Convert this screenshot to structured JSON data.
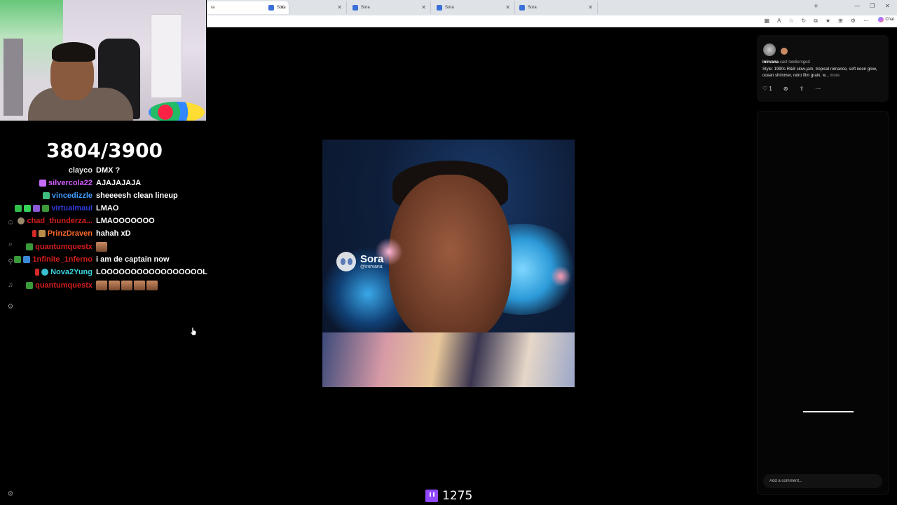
{
  "browser": {
    "tabs": [
      {
        "label": "ra",
        "x": 0
      },
      {
        "label": "Sora"
      },
      {
        "label": "Sora"
      },
      {
        "label": "Sora"
      },
      {
        "label": "Sora"
      }
    ],
    "chat_button_label": "Chat"
  },
  "stream": {
    "goal_text": "3804/3900",
    "viewer_count": "1275",
    "accent_color": "#9147ff"
  },
  "chat": {
    "messages": [
      {
        "user": "clayco",
        "color": "#e6e6e6",
        "text": "DMX ?"
      },
      {
        "user": "silvercola22",
        "color": "#d35cff",
        "text": "AJAJAJAJA"
      },
      {
        "user": "vincedizzle",
        "color": "#3f9bff",
        "text": "sheeeesh clean lineup"
      },
      {
        "user": "virtualmaul",
        "color": "#2f3bd8",
        "text": "LMAO"
      },
      {
        "user": "chad_thunderza...",
        "color": "#d41d1d",
        "text": "LMAOOOOOOO"
      },
      {
        "user": "PrinzDraven",
        "color": "#ff6a2b",
        "text": "hahah xD"
      },
      {
        "user": "quantumquestx",
        "color": "#d41d1d",
        "text": ""
      },
      {
        "user": "1nfinite_1nferno",
        "color": "#d41d1d",
        "text": "i am de captain now"
      },
      {
        "user": "Nova2Yung",
        "color": "#39d6e0",
        "text": "LOOOOOOOOOOOOOOOOOL"
      },
      {
        "user": "quantumquestx",
        "color": "#d41d1d",
        "text": ""
      }
    ]
  },
  "video": {
    "watermark_name": "Sora",
    "watermark_handle": "@inirvana"
  },
  "post": {
    "author": "inirvana",
    "cast_text": "cast lowtiersgod",
    "description": "Style: 1990s R&B slow-jam, tropical romance, soft neon glow, ocean shimmer, retro film grain, w...",
    "more_label": "more",
    "like_count": "1",
    "comment_placeholder": "Add a comment..."
  }
}
